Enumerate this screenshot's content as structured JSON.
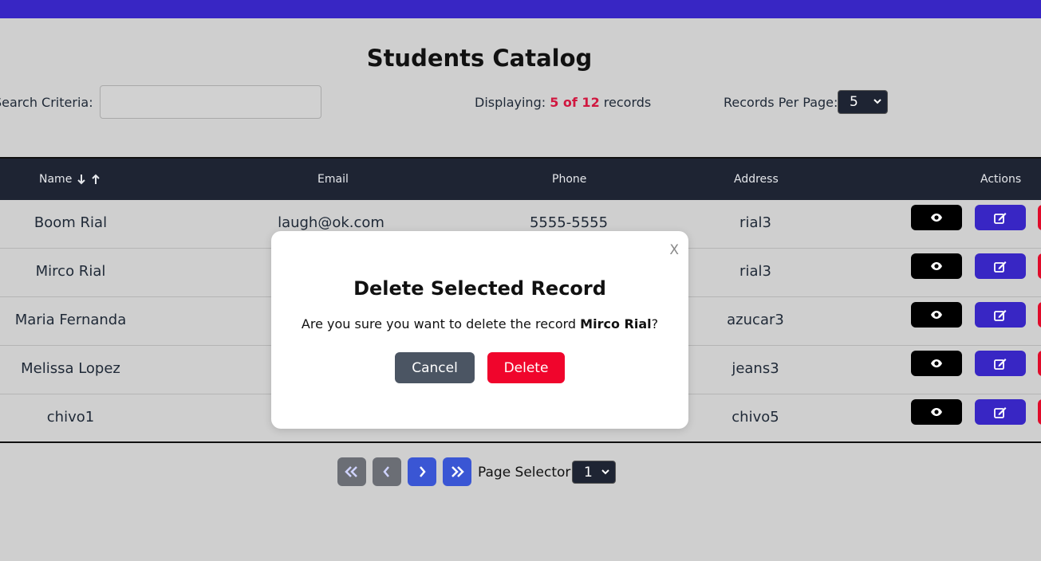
{
  "page": {
    "title": "Students Catalog"
  },
  "search": {
    "label": "Search Criteria:",
    "value": ""
  },
  "status": {
    "prefix": "Displaying:",
    "count": "5 of 12",
    "suffix": "records"
  },
  "records_per_page": {
    "label": "Records Per Page:",
    "value": "5"
  },
  "table": {
    "headers": {
      "name": "Name",
      "email": "Email",
      "phone": "Phone",
      "address": "Address",
      "actions": "Actions"
    },
    "rows": [
      {
        "name": "Boom Rial",
        "email": "laugh@ok.com",
        "phone": "5555-5555",
        "address": "rial3"
      },
      {
        "name": "Mirco Rial",
        "email": "",
        "phone": "",
        "address": "rial3"
      },
      {
        "name": "Maria Fernanda",
        "email": "",
        "phone": "",
        "address": "azucar3"
      },
      {
        "name": "Melissa Lopez",
        "email": "",
        "phone": "",
        "address": "jeans3"
      },
      {
        "name": "chivo1",
        "email": "",
        "phone": "",
        "address": "chivo5"
      }
    ]
  },
  "pagination": {
    "page_label": "Page Selector:",
    "page_value": "1"
  },
  "modal": {
    "close": "X",
    "title": "Delete Selected Record",
    "message_prefix": "Are you sure you want to delete the record ",
    "record_name": "Mirco Rial",
    "message_suffix": "?",
    "cancel_label": "Cancel",
    "delete_label": "Delete"
  },
  "colors": {
    "topbar": "#3826c4",
    "header": "#1e2433",
    "edit": "#3826c4",
    "delete": "#e00b2a",
    "count": "#d0173f"
  },
  "icons": {
    "sort": "arrow-down-up-icon",
    "view": "eye-icon",
    "edit": "edit-icon",
    "first": "double-chevron-left-icon",
    "prev": "chevron-left-icon",
    "next": "chevron-right-icon",
    "last": "double-chevron-right-icon"
  }
}
